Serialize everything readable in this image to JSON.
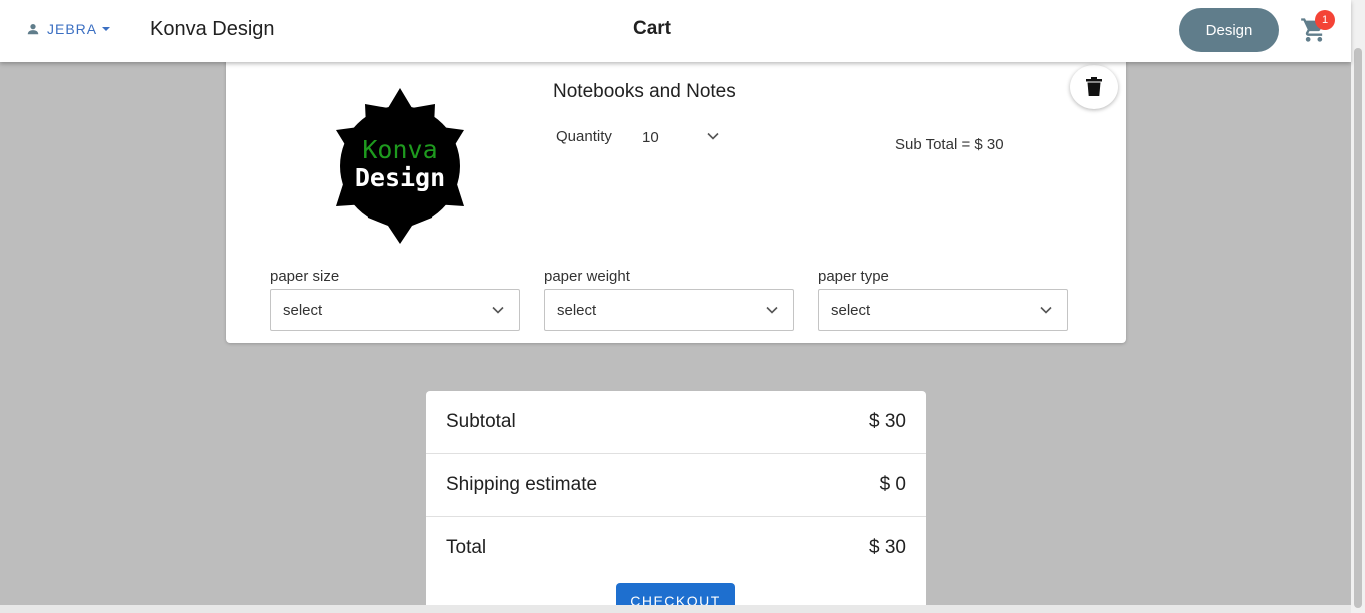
{
  "header": {
    "username": "JEBRA",
    "brand": "Konva Design",
    "title": "Cart",
    "design_button": "Design",
    "cart_count": "1"
  },
  "product": {
    "name": "Notebooks and Notes",
    "logo_line1": "Konva",
    "logo_line2": "Design",
    "quantity_label": "Quantity",
    "quantity_value": "10",
    "subtotal_text": "Sub Total = $ 30",
    "options": [
      {
        "label": "paper size",
        "value": "select"
      },
      {
        "label": "paper weight",
        "value": "select"
      },
      {
        "label": "paper type",
        "value": "select"
      }
    ]
  },
  "summary": {
    "rows": [
      {
        "label": "Subtotal",
        "amount": "$ 30"
      },
      {
        "label": "Shipping estimate",
        "amount": "$ 0"
      },
      {
        "label": "Total",
        "amount": "$ 30"
      }
    ],
    "checkout_label": "CHECKOUT"
  },
  "colors": {
    "accent": "#1e6fcf",
    "design_button": "#607d8b",
    "badge": "#f44336",
    "logo_green": "#1e9a1e",
    "background": "#bdbdbd"
  },
  "icons": [
    "person-icon",
    "caret-down-icon",
    "cart-icon",
    "trash-icon",
    "chevron-down-icon"
  ]
}
